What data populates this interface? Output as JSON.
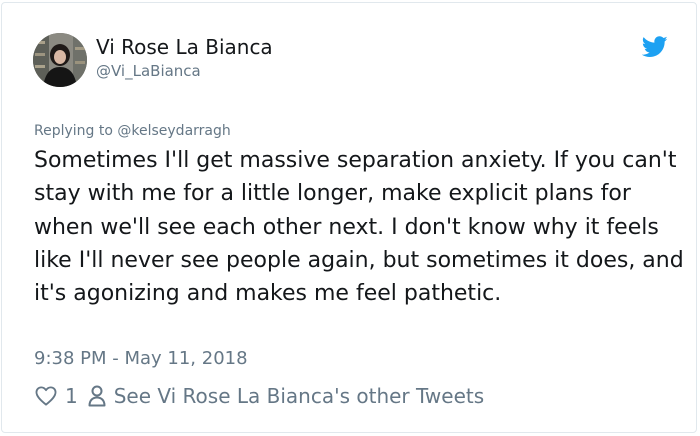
{
  "tweet": {
    "display_name": "Vi Rose La Bianca",
    "handle": "@Vi_LaBianca",
    "replying_to": "Replying to @kelseydarragh",
    "text": "Sometimes I'll get massive separation anxiety. If you can't stay with me for a little longer, make explicit plans for when we'll see each other next. I don't know why it feels like I'll never see people again, but sometimes it does, and it's agonizing and makes me feel pathetic.",
    "timestamp": "9:38 PM - May 11, 2018",
    "like_count": "1",
    "other_tweets_link": "See Vi Rose La Bianca's other Tweets"
  },
  "icons": {
    "brand": "twitter-bird-icon",
    "like": "heart-icon",
    "profile": "person-icon"
  },
  "colors": {
    "twitter_blue": "#1da1f2",
    "text_primary": "#14171a",
    "text_secondary": "#657786",
    "border": "#e1e8ed"
  }
}
